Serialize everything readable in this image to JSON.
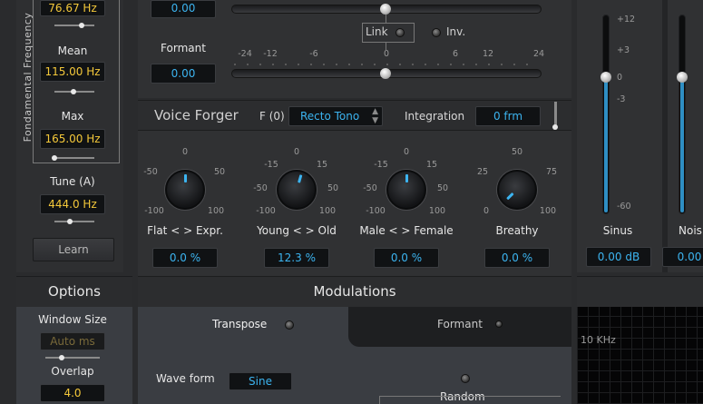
{
  "left_panel": {
    "vertical_label": "Fondamental Frequency",
    "min_value": "76.67 Hz",
    "mean_label": "Mean",
    "mean_value": "115.00 Hz",
    "max_label": "Max",
    "max_value": "165.00 Hz",
    "tune_label": "Tune (A)",
    "tune_value": "444.0 Hz",
    "learn_label": "Learn"
  },
  "options": {
    "title": "Options",
    "window_size_label": "Window Size",
    "window_size_value": "Auto ms",
    "overlap_label": "Overlap",
    "overlap_value": "4.0"
  },
  "pitch": {
    "transpose_value": "0.00",
    "link_label": "Link",
    "inv_label": "Inv.",
    "formant_label": "Formant",
    "formant_value": "0.00",
    "scale_ticks": [
      "-24",
      "-12",
      "-6",
      "0",
      "6",
      "12",
      "24"
    ]
  },
  "voice_forger": {
    "title": "Voice Forger",
    "f0_label": "F (0)",
    "f0_value": "Recto Tono",
    "integration_label": "Integration",
    "integration_value": "0 frm",
    "knobs": [
      {
        "name": "Flat < > Expr.",
        "value": "0.0 %",
        "ticks": [
          "0",
          "-50",
          "50",
          "-100",
          "100"
        ],
        "level": 0.5
      },
      {
        "name": "Young < > Old",
        "value": "12.3 %",
        "ticks": [
          "0",
          "-15",
          "15",
          "-50",
          "50",
          "-100",
          "100"
        ],
        "level": 0.56
      },
      {
        "name": "Male < > Female",
        "value": "0.0 %",
        "ticks": [
          "0",
          "-15",
          "15",
          "-50",
          "50",
          "-100",
          "100"
        ],
        "level": 0.5
      },
      {
        "name": "Breathy",
        "value": "0.0 %",
        "ticks": [
          "50",
          "25",
          "75",
          "0",
          "100"
        ],
        "level": 0.0
      }
    ]
  },
  "mixer": {
    "scale": [
      "+12",
      "+3",
      "0",
      "-3",
      "-60"
    ],
    "sinus_label": "Sinus",
    "sinus_value": "0.00 dB",
    "noise_label": "Nois",
    "noise_value": "0.00"
  },
  "modulations": {
    "title": "Modulations",
    "tab_transpose": "Transpose",
    "tab_formant": "Formant",
    "waveform_label": "Wave form",
    "waveform_value": "Sine",
    "random_label": "Random"
  },
  "spectrum": {
    "freq_label": "10 KHz"
  },
  "colors": {
    "accent_blue": "#3cb4f0",
    "value_yellow": "#f4c83a",
    "panel_bg": "#303133"
  }
}
